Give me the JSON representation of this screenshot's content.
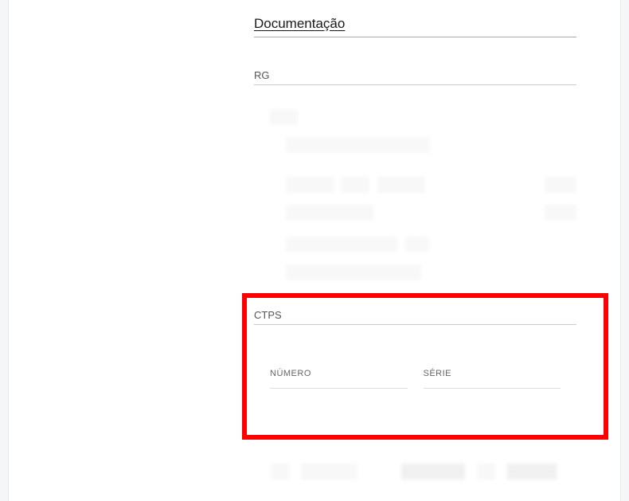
{
  "sections": {
    "main_title": "Documentação",
    "rg_label": "RG",
    "ctps_label": "CTPS",
    "ctps_fields": {
      "numero_label": "NÚMERO",
      "serie_label": "SÉRIE",
      "numero_value": "",
      "serie_value": ""
    }
  }
}
